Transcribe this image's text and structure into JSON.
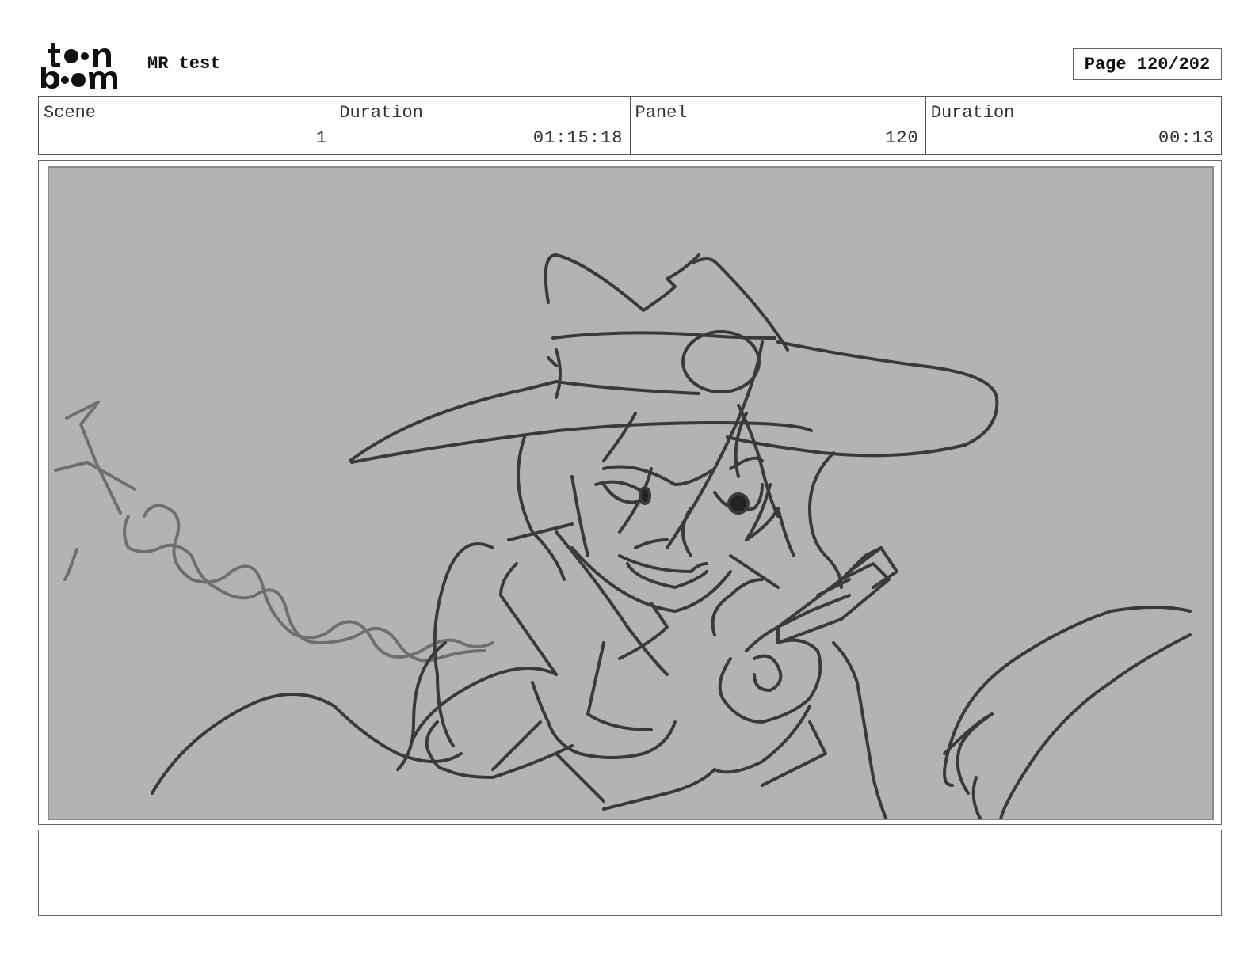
{
  "header": {
    "logo": {
      "line1": "toon",
      "line2": "boom"
    },
    "project_title": "MR test",
    "page_label": "Page 120/202"
  },
  "info": [
    {
      "label": "Scene",
      "value": "1"
    },
    {
      "label": "Duration",
      "value": "01:15:18"
    },
    {
      "label": "Panel",
      "value": "120"
    },
    {
      "label": "Duration",
      "value": "00:13"
    }
  ],
  "panel": {
    "background_color": "#b3b3b3",
    "sketch_color": "#3a3a3a",
    "rope_color": "#6f6f6f",
    "sketch_subject": "cowgirl-with-pistol-sketch"
  },
  "notes": {
    "text": ""
  }
}
